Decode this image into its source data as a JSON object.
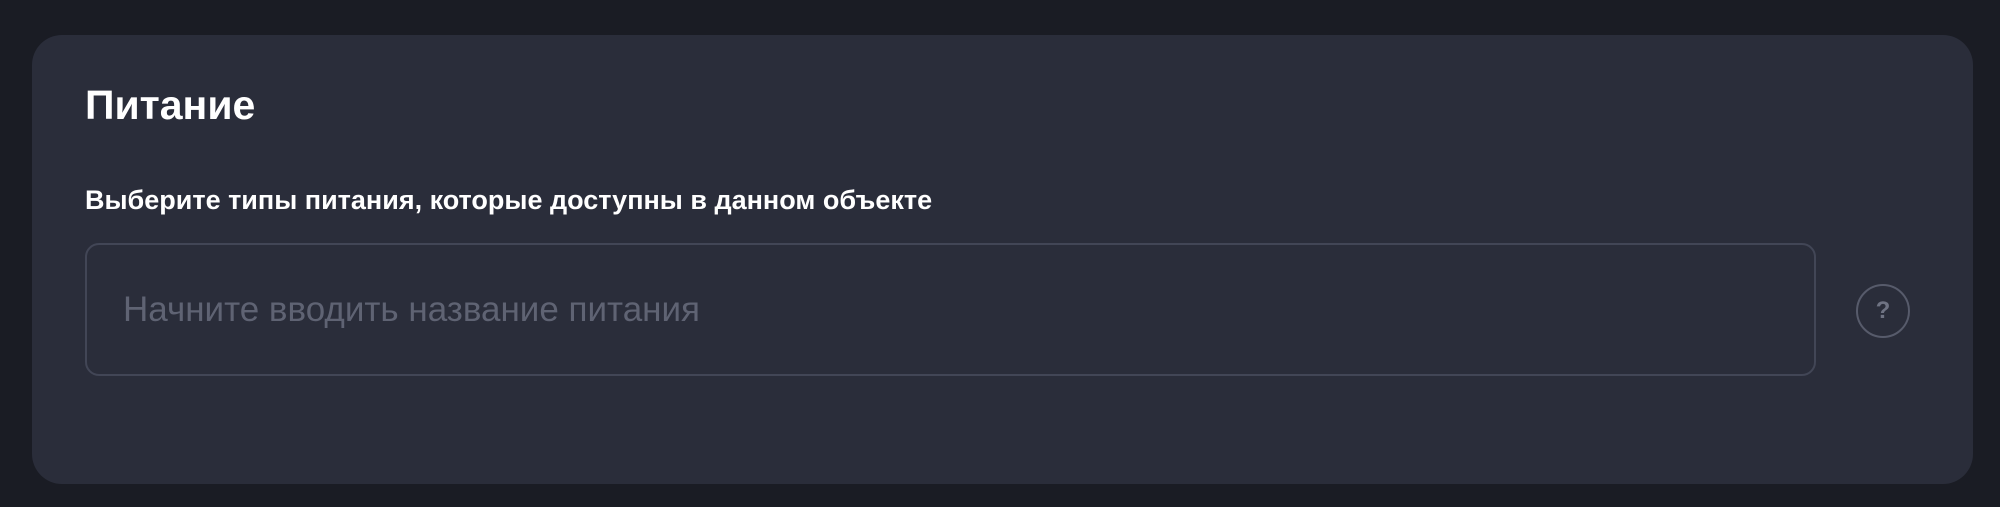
{
  "section": {
    "title": "Питание",
    "label": "Выберите типы питания, которые доступны в данном объекте",
    "input": {
      "value": "",
      "placeholder": "Начните вводить название питания"
    },
    "help": {
      "icon": "question-icon",
      "glyph": "?"
    }
  }
}
